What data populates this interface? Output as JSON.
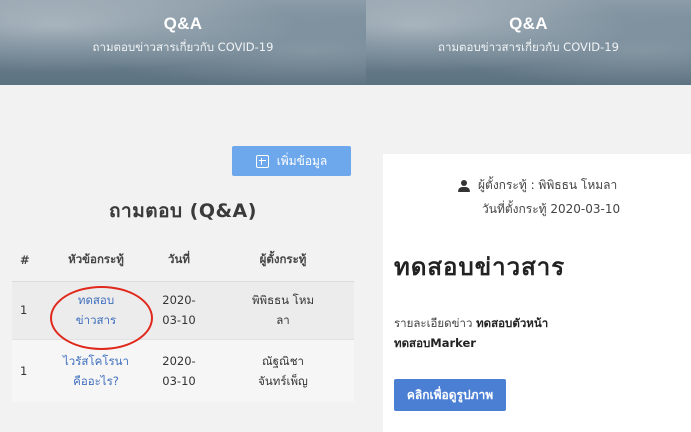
{
  "left_panel": {
    "header": {
      "title": "Q&A",
      "subtitle": "ถามตอบข่าวสารเกี่ยวกับ COVID-19"
    },
    "add_button_label": "เพิ่มข้อมูล",
    "heading": "ถามตอบ (Q&A)",
    "table": {
      "headers": [
        "#",
        "หัวข้อกระทู้",
        "วันที่",
        "ผู้ตั้งกระทู้"
      ],
      "rows": [
        {
          "num": "1",
          "topic": [
            "ทดสอบ",
            "ข่าวสาร"
          ],
          "date": [
            "2020-",
            "03-10"
          ],
          "author": [
            "พิพิธธน โหม",
            "ลา"
          ]
        },
        {
          "num": "1",
          "topic": [
            "ไวรัสโคโรนา",
            "คืออะไร?"
          ],
          "date": [
            "2020-",
            "03-10"
          ],
          "author": [
            "ณัฐณิชา",
            "จันทร์เพ็ญ"
          ]
        }
      ]
    }
  },
  "right_panel": {
    "header": {
      "title": "Q&A",
      "subtitle": "ถามตอบข่าวสารเกี่ยวกับ COVID-19"
    },
    "poster": "ผู้ตั้งกระทู้ : พิพิธธน โหมลา",
    "posted_date": "วันที่ตั้งกระทู้ 2020-03-10",
    "news_title": "ทดสอบข่าวสาร",
    "detail_label": "รายละเอียดข่าว",
    "detail_bold_1": "ทดสอบตัวหน้า",
    "detail_bold_2": "ทดสอบMarker",
    "view_button_label": "คลิกเพื่อดูรูปภาพ"
  },
  "colors": {
    "accent_blue": "#4a7fd4",
    "add_button_blue": "#6ea8ec",
    "link_blue": "#3f6fbe",
    "annotation_red": "#e0281c"
  },
  "icons": [
    "plus-box-icon",
    "user-icon"
  ]
}
